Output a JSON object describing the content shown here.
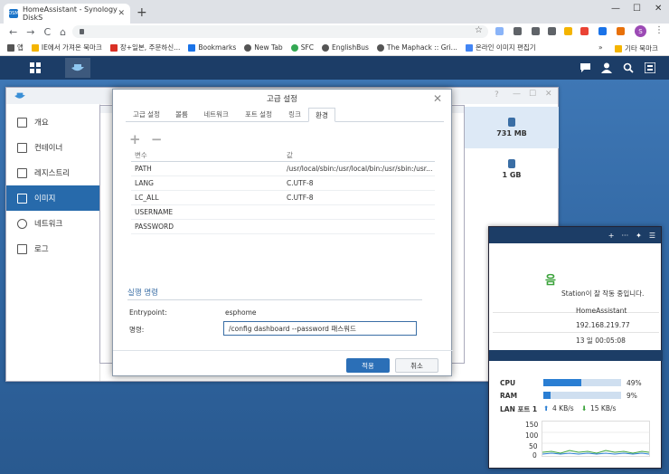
{
  "browser": {
    "tab_title": "HomeAssistant - Synology DiskS",
    "tab_close": "✕",
    "new_tab": "+",
    "win_controls": [
      "—",
      "☐",
      "✕"
    ],
    "nav": [
      "←",
      "→",
      "C",
      "⌂"
    ],
    "profile_initial": "S"
  },
  "bookmarks": [
    {
      "label": "앱",
      "color": "#555555"
    },
    {
      "label": "IE에서 가져온 북마크",
      "color": "#f4b400"
    },
    {
      "label": "장+일본, 주문하신...",
      "color": "#d93025"
    },
    {
      "label": "Bookmarks",
      "color": "#1a73e8"
    },
    {
      "label": "New Tab",
      "color": "#555555"
    },
    {
      "label": "SFC",
      "color": "#34a853"
    },
    {
      "label": "EnglishBus",
      "color": "#555555"
    },
    {
      "label": "The Maphack :: Gri...",
      "color": "#555555"
    },
    {
      "label": "온라인 이미지 편집기",
      "color": "#4285f4"
    }
  ],
  "bookmarks_more": "»",
  "bookmarks_other": "기타 북마크",
  "sidebar": {
    "items": [
      {
        "label": "개요"
      },
      {
        "label": "컨테이너"
      },
      {
        "label": "레지스트리"
      },
      {
        "label": "이미지"
      },
      {
        "label": "네트워크"
      },
      {
        "label": "로그"
      }
    ]
  },
  "right_panel": {
    "sizes": [
      "731 MB",
      "1 GB"
    ]
  },
  "modal": {
    "title": "고급 설정",
    "close": "✕",
    "tabs": [
      "고급 설정",
      "볼륨",
      "네트워크",
      "포트 설정",
      "링크",
      "환경"
    ],
    "add_icon": "+",
    "remove_icon": "−",
    "table_headers": [
      "변수",
      "값"
    ],
    "env_rows": [
      {
        "name": "PATH",
        "value": "/usr/local/sbin:/usr/local/bin:/usr/sbin:/usr..."
      },
      {
        "name": "LANG",
        "value": "C.UTF-8"
      },
      {
        "name": "LC_ALL",
        "value": "C.UTF-8"
      },
      {
        "name": "USERNAME",
        "value": ""
      },
      {
        "name": "PASSWORD",
        "value": ""
      }
    ],
    "section_title": "실행 명령",
    "entrypoint_label": "Entrypoint:",
    "entrypoint_value": "esphome",
    "command_label": "명령:",
    "command_value": "/config dashboard --password 패스워드",
    "apply_label": "적용",
    "cancel_label": "취소"
  },
  "widget": {
    "status": "음",
    "status_text": "Station이 잘 작동 중입니다.",
    "info": [
      "HomeAssistant",
      "192.168.219.77",
      "13 일 00:05:08"
    ],
    "cpu_label": "CPU",
    "cpu_value": "49%",
    "cpu_percent": 49,
    "ram_label": "RAM",
    "ram_value": "9%",
    "ram_percent": 9,
    "lan_label": "LAN 포트 1",
    "lan_up": "4 KB/s",
    "lan_down": "15 KB/s",
    "graph_ticks": [
      "150",
      "100",
      "50",
      "0"
    ]
  }
}
